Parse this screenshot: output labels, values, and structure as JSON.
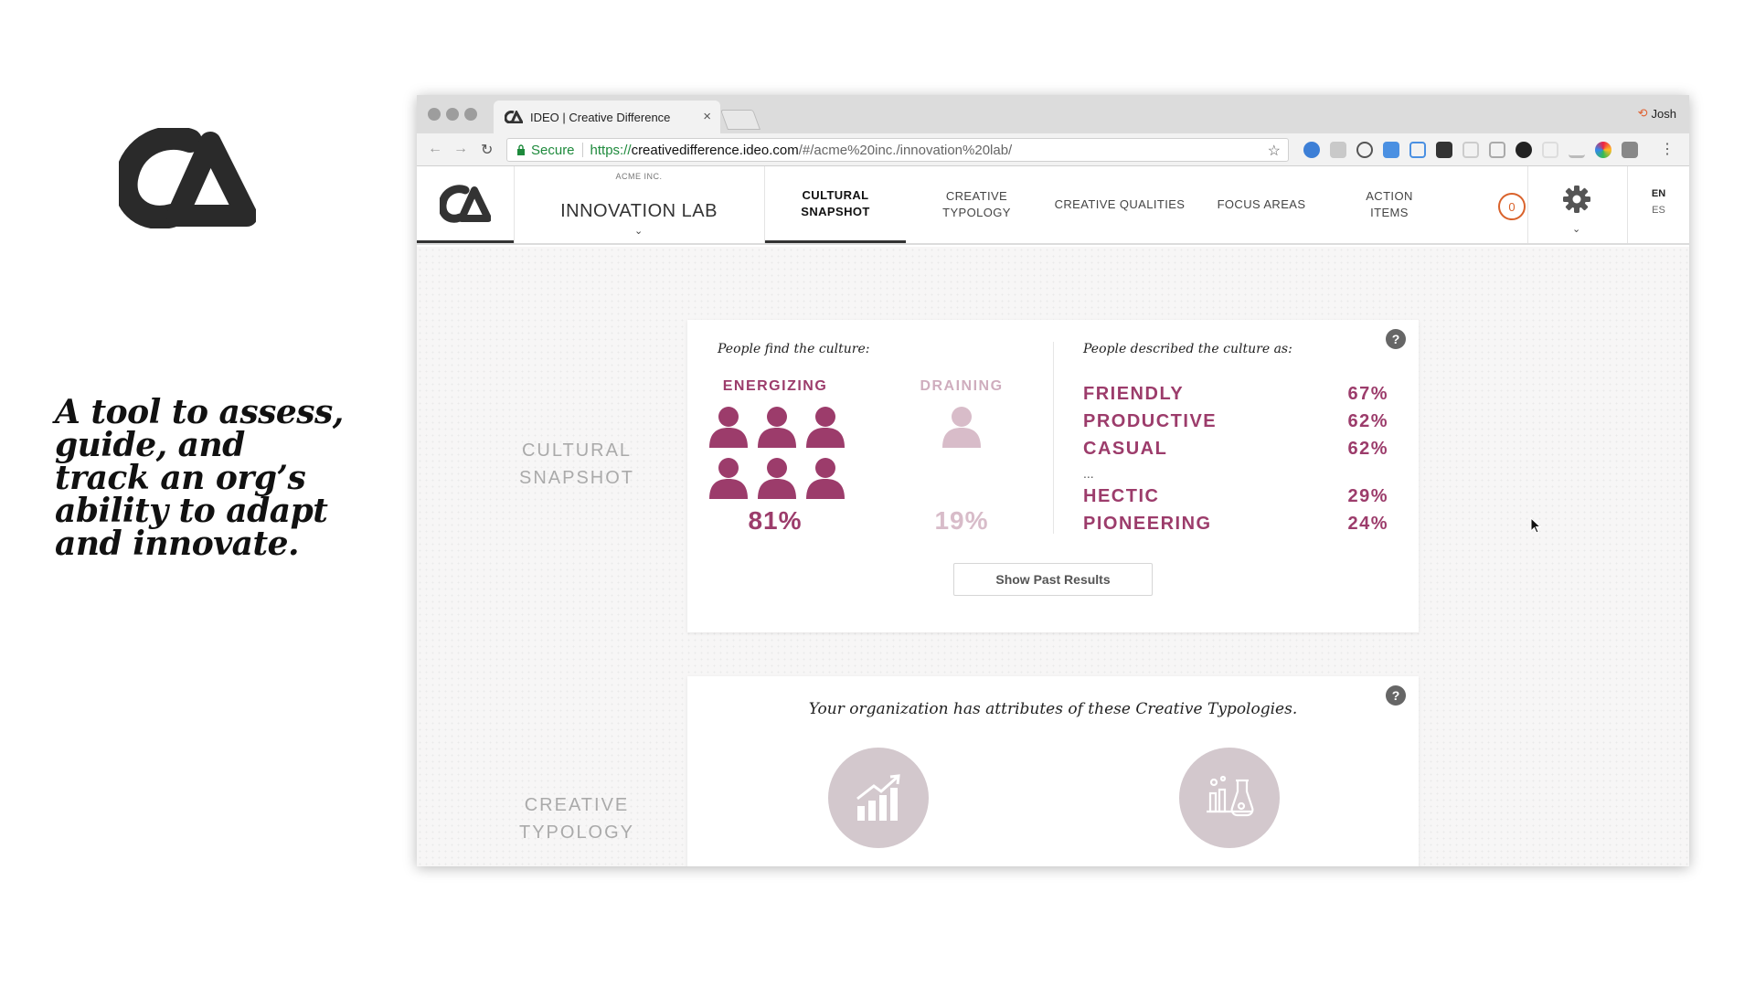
{
  "slide": {
    "tagline": "A tool to assess, guide, and track an org’s ability to adapt and innovate."
  },
  "browser": {
    "tab_title": "IDEO | Creative Difference",
    "tab_close": "×",
    "user_name": "Josh",
    "secure_label": "Secure",
    "url_scheme": "https://",
    "url_host": "creativedifference.ideo.com",
    "url_path": "/#/acme%20inc./innovation%20lab/"
  },
  "header": {
    "company": "ACME INC.",
    "org_name": "INNOVATION LAB",
    "nav": [
      {
        "label": "CULTURAL\nSNAPSHOT",
        "active": true
      },
      {
        "label": "CREATIVE\nTYPOLOGY",
        "active": false
      },
      {
        "label": "CREATIVE QUALITIES",
        "active": false
      },
      {
        "label": "FOCUS AREAS",
        "active": false
      },
      {
        "label": "ACTION\nITEMS",
        "active": false
      }
    ],
    "action_count": "0",
    "languages": [
      "EN",
      "ES"
    ]
  },
  "sections": {
    "cultural_snapshot_label": "CULTURAL\nSNAPSHOT",
    "creative_typology_label": "CREATIVE\nTYPOLOGY"
  },
  "snapshot": {
    "find_intro": "People find the culture:",
    "energizing": {
      "title": "ENERGIZING",
      "percent": "81%",
      "people_filled": 6
    },
    "draining": {
      "title": "DRAINING",
      "percent": "19%",
      "people_filled": 1
    },
    "described_intro": "People described the culture as:",
    "descriptors_top": [
      {
        "word": "FRIENDLY",
        "percent": "67%"
      },
      {
        "word": "PRODUCTIVE",
        "percent": "62%"
      },
      {
        "word": "CASUAL",
        "percent": "62%"
      }
    ],
    "ellipsis": "...",
    "descriptors_bottom": [
      {
        "word": "HECTIC",
        "percent": "29%"
      },
      {
        "word": "PIONEERING",
        "percent": "24%"
      }
    ],
    "past_results_button": "Show Past Results",
    "help": "?"
  },
  "typology": {
    "intro": "Your organization has attributes of these Creative Typologies.",
    "icons": [
      "growth-chart-icon",
      "lab-experiment-icon"
    ],
    "help": "?"
  },
  "colors": {
    "accent": "#9c3c6b",
    "accent_light": "#cfadbe",
    "badge": "#d9622b"
  }
}
